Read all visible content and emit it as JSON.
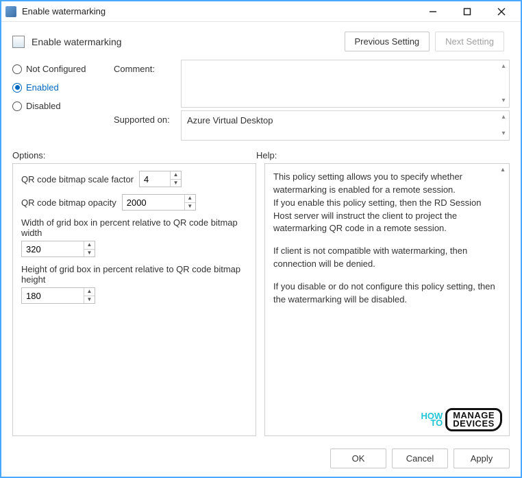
{
  "window": {
    "title": "Enable watermarking"
  },
  "header": {
    "page_title": "Enable watermarking",
    "prev_label": "Previous Setting",
    "next_label": "Next Setting"
  },
  "state": {
    "not_configured_label": "Not Configured",
    "enabled_label": "Enabled",
    "disabled_label": "Disabled",
    "selected": "Enabled"
  },
  "fields": {
    "comment_label": "Comment:",
    "comment_value": "",
    "supported_label": "Supported on:",
    "supported_value": "Azure Virtual Desktop"
  },
  "sections": {
    "options_label": "Options:",
    "help_label": "Help:"
  },
  "options": {
    "scale_label": "QR code bitmap scale factor",
    "scale_value": "4",
    "opacity_label": "QR code bitmap opacity",
    "opacity_value": "2000",
    "width_label": "Width of grid box in percent relative to QR code bitmap width",
    "width_value": "320",
    "height_label": "Height of grid box in percent relative to QR code bitmap height",
    "height_value": "180"
  },
  "help": {
    "p1": "This policy setting allows you to specify whether watermarking is enabled for a remote session.",
    "p2": "If you enable this policy setting, then the RD Session Host server will instruct the client to project the watermarking QR code in a remote session.",
    "p3": "If client is not compatible with watermarking, then connection will be denied.",
    "p4": "If you disable or do not configure this policy setting, then the watermarking will be disabled."
  },
  "footer": {
    "ok": "OK",
    "cancel": "Cancel",
    "apply": "Apply"
  },
  "branding": {
    "how": "HOW",
    "to": "TO",
    "manage": "MANAGE",
    "devices": "DEVICES"
  }
}
